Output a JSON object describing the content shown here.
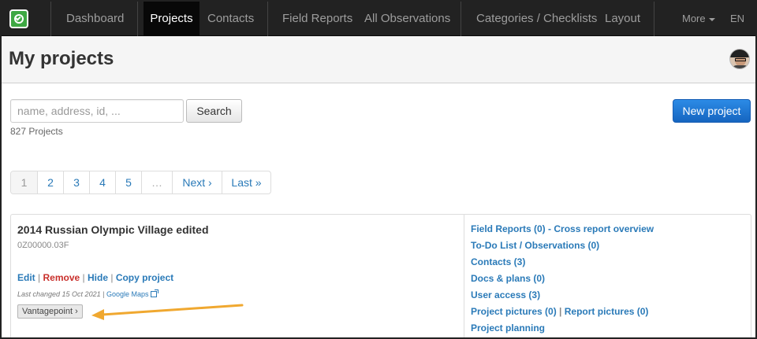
{
  "navbar": {
    "items": [
      {
        "label": "Dashboard"
      },
      {
        "label": "Projects"
      },
      {
        "label": "Contacts"
      },
      {
        "label": "Field Reports"
      },
      {
        "label": "All Observations"
      },
      {
        "label": "Categories / Checklists"
      },
      {
        "label": "Layout"
      }
    ],
    "more_label": "More",
    "language": "EN",
    "accent_color": "#3ea843"
  },
  "header": {
    "title": "My projects"
  },
  "search": {
    "placeholder": "name, address, id, ...",
    "value": "",
    "button_label": "Search",
    "count_text": "827 Projects"
  },
  "new_project_label": "New project",
  "pagination": {
    "pages": [
      "1",
      "2",
      "3",
      "4",
      "5",
      "…",
      "Next ›",
      "Last »"
    ],
    "current": "1"
  },
  "project": {
    "name": "2014 Russian Olympic Village edited",
    "code": "0Z00000.03F",
    "actions": {
      "edit": "Edit",
      "remove": "Remove",
      "hide": "Hide",
      "copy": "Copy project",
      "separator": "|"
    },
    "last_changed": "Last changed 15 Oct 2021",
    "maps_link": "Google Maps",
    "tag": "Vantagepoint ›",
    "links": {
      "field_reports": "Field Reports (0)",
      "cross_report": "- Cross report overview",
      "todo": "To-Do List / Observations (0)",
      "contacts": "Contacts (3)",
      "docs": "Docs & plans (0)",
      "user_access": "User access (3)",
      "project_pictures": "Project pictures (0)",
      "report_pictures": "Report pictures (0)",
      "planning": "Project planning"
    }
  },
  "annotation": {
    "arrow_color": "#f0a830"
  }
}
